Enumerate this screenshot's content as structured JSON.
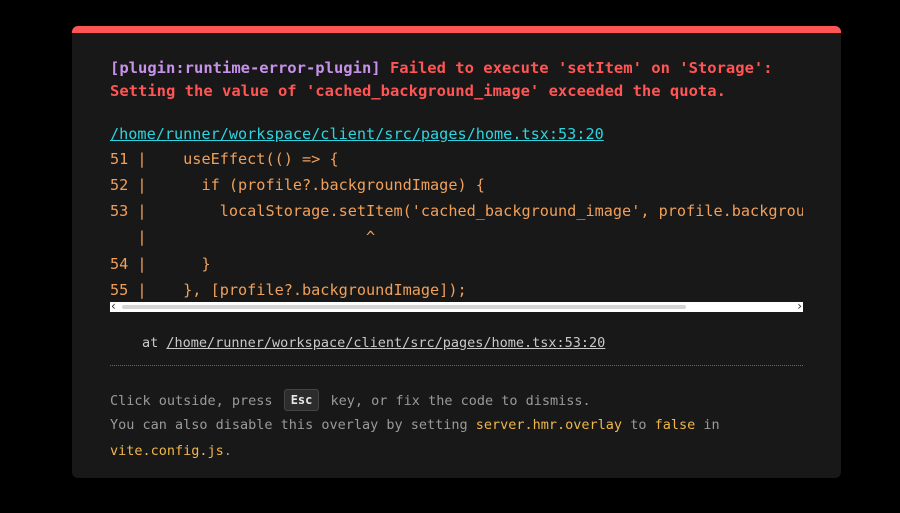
{
  "error": {
    "plugin": "[plugin:runtime-error-plugin]",
    "message_line1": "Failed to execute 'setItem' on 'Storage':",
    "message_line2": "Setting the value of 'cached_background_image' exceeded the quota.",
    "file": "/home/runner/workspace/client/src/pages/home.tsx:53:20"
  },
  "frame": {
    "lines": [
      {
        "gutter": "51 |",
        "code": "    useEffect(() => {"
      },
      {
        "gutter": "52 |",
        "code": "      if (profile?.backgroundImage) {"
      },
      {
        "gutter": "53 |",
        "code": "        localStorage.setItem('cached_background_image', profile.backgroundImage);"
      },
      {
        "gutter": "   |",
        "code": "                        ^"
      },
      {
        "gutter": "54 |",
        "code": "      }"
      },
      {
        "gutter": "55 |",
        "code": "    }, [profile?.backgroundImage]);"
      }
    ]
  },
  "stack": {
    "prefix": "at ",
    "path": "/home/runner/workspace/client/src/pages/home.tsx:53:20"
  },
  "tip": {
    "line1_a": "Click outside, press",
    "key": "Esc",
    "line1_b": "key, or fix the code to dismiss.",
    "line2_a": "You can also disable this overlay by setting ",
    "config_key": "server.hmr.overlay",
    "line2_b": " to ",
    "config_value": "false",
    "line2_c": " in",
    "config_file": "vite.config.js",
    "line3_end": "."
  },
  "icons": {
    "left_arrow": "‹",
    "right_arrow": "›"
  },
  "colors": {
    "error": "#ff5555",
    "plugin": "#c792ea",
    "file_link": "#2dd4e0",
    "code": "#f0a05a"
  }
}
